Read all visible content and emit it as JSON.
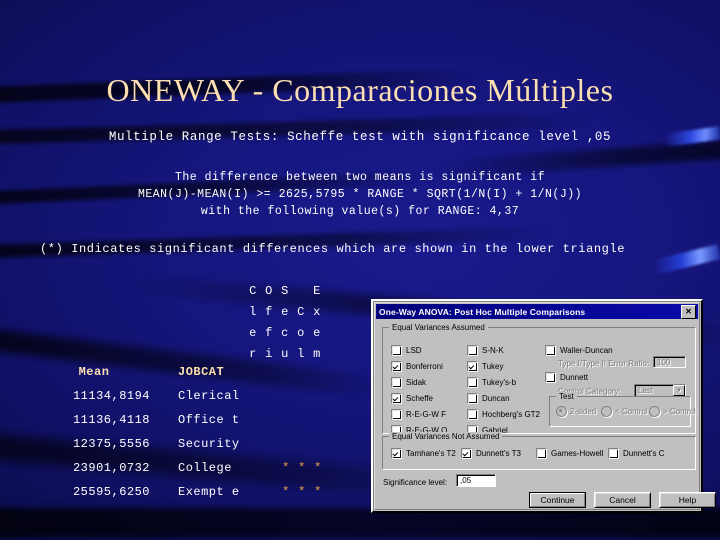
{
  "slide": {
    "title": "ONEWAY - Comparaciones Múltiples",
    "subtitle": "Multiple Range Tests:   Scheffe test with significance level ,05",
    "formula_lines": [
      "The difference between two means is significant if",
      "MEAN(J)-MEAN(I)  >= 2625,5795 * RANGE * SQRT(1/N(I) + 1/N(J))",
      "with the following value(s) for RANGE: 4,37"
    ],
    "indicator_note": "(*) Indicates significant differences which are shown in the lower triangle",
    "letter_grid": [
      [
        "C",
        "O",
        "S",
        " ",
        "E"
      ],
      [
        "l",
        "f",
        "e",
        "C",
        "x"
      ],
      [
        "e",
        "f",
        "c",
        "o",
        "e"
      ],
      [
        "r",
        "i",
        "u",
        "l",
        "m"
      ]
    ],
    "table": {
      "headers": {
        "mean": "Mean",
        "jobcat": "JOBCAT"
      },
      "rows": [
        {
          "mean": "11134,8194",
          "jobcat": "Clerical",
          "stars": ""
        },
        {
          "mean": "11136,4118",
          "jobcat": "Office t",
          "stars": ""
        },
        {
          "mean": "12375,5556",
          "jobcat": "Security",
          "stars": ""
        },
        {
          "mean": "23901,0732",
          "jobcat": "College",
          "stars": "* * *"
        },
        {
          "mean": "25595,6250",
          "jobcat": "Exempt e",
          "stars": "* * *"
        }
      ]
    },
    "colors": {
      "title": "#fbdfb1",
      "body_text": "#ffffff",
      "header_text": "#fbdfb1",
      "star": "#f0a24a",
      "background": "#16167f",
      "accent_streak": "#2b47e0"
    }
  },
  "dialog": {
    "title": "One-Way ANOVA: Post Hoc Multiple Comparisons",
    "close_label": "✕",
    "equal_variances": {
      "legend": "Equal Variances Assumed",
      "column1": [
        {
          "label": "LSD",
          "checked": false
        },
        {
          "label": "Bonferroni",
          "checked": true
        },
        {
          "label": "Sidak",
          "checked": false
        },
        {
          "label": "Scheffe",
          "checked": true
        },
        {
          "label": "R-E-G-W F",
          "checked": false
        },
        {
          "label": "R-E-G-W Q",
          "checked": false
        }
      ],
      "column2": [
        {
          "label": "S-N-K",
          "checked": false
        },
        {
          "label": "Tukey",
          "checked": true
        },
        {
          "label": "Tukey's-b",
          "checked": false
        },
        {
          "label": "Duncan",
          "checked": false
        },
        {
          "label": "Hochberg's GT2",
          "checked": false
        },
        {
          "label": "Gabriel",
          "checked": false
        }
      ],
      "waller_duncan": {
        "label": "Waller-Duncan",
        "checked": false
      },
      "error_ratio": {
        "label": "Type I/Type II Error Ratio:",
        "value": "100"
      },
      "dunnett": {
        "label": "Dunnett",
        "checked": false
      },
      "control_category": {
        "label": "Control Category:",
        "value": "Last"
      },
      "test_group": {
        "legend": "Test",
        "options": [
          {
            "label": "2-sided",
            "selected": true
          },
          {
            "label": "< Control",
            "selected": false
          },
          {
            "label": "> Control",
            "selected": false
          }
        ]
      }
    },
    "unequal_variances": {
      "legend": "Equal Variances Not Assumed",
      "items": [
        {
          "label": "Tamhane's T2",
          "checked": true
        },
        {
          "label": "Dunnett's T3",
          "checked": true
        },
        {
          "label": "Games-Howell",
          "checked": false
        },
        {
          "label": "Dunnett's C",
          "checked": false
        }
      ]
    },
    "significance": {
      "label": "Significance level:",
      "value": ",05"
    },
    "buttons": [
      {
        "label": "Continue",
        "default": true
      },
      {
        "label": "Cancel",
        "default": false
      },
      {
        "label": "Help",
        "default": false
      }
    ]
  }
}
